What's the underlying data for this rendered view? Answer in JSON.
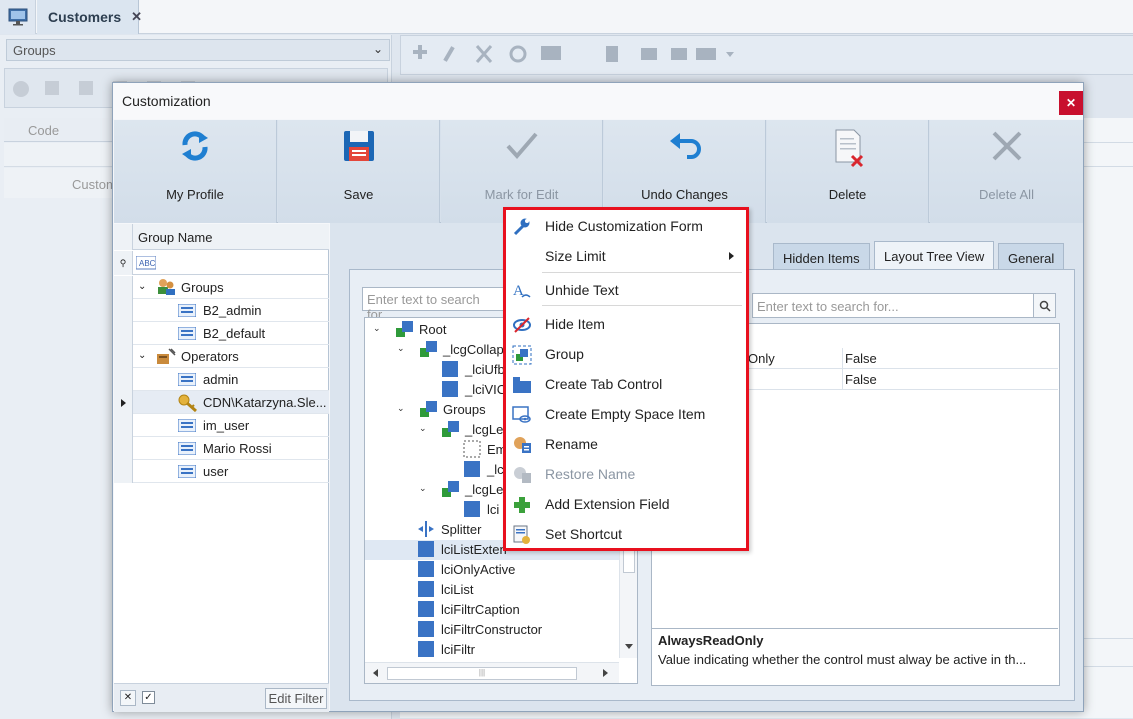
{
  "app": {
    "tab_title": "Customers",
    "tab_close": "✕",
    "groups_combo": "Groups",
    "left_grid_col": "Code",
    "left_grid_row": "Custom"
  },
  "dialog": {
    "title": "Customization",
    "close": "✕",
    "ribbon": [
      {
        "label": "My Profile",
        "icon": "refresh-icon",
        "enabled": true
      },
      {
        "label": "Save",
        "icon": "save-icon",
        "enabled": true
      },
      {
        "label": "Mark for Edit",
        "icon": "checkmark-icon",
        "enabled": false
      },
      {
        "label": "Undo Changes",
        "icon": "undo-icon",
        "enabled": true
      },
      {
        "label": "Delete",
        "icon": "delete-doc-icon",
        "enabled": true
      },
      {
        "label": "Delete All",
        "icon": "x-icon",
        "enabled": false
      }
    ]
  },
  "users_grid": {
    "header": "Group Name",
    "rows": [
      {
        "label": "Groups",
        "level": 0,
        "expanded": true
      },
      {
        "label": "B2_admin",
        "level": 1
      },
      {
        "label": "B2_default",
        "level": 1
      },
      {
        "label": "Operators",
        "level": 0,
        "expanded": true
      },
      {
        "label": "admin",
        "level": 1
      },
      {
        "label": "CDN\\Katarzyna.Sle...",
        "level": 1,
        "selected": true
      },
      {
        "label": "im_user",
        "level": 1
      },
      {
        "label": "Mario Rossi",
        "level": 1
      },
      {
        "label": "user",
        "level": 1
      }
    ],
    "edit_filter": "Edit Filter"
  },
  "tabs": [
    {
      "label": "Hidden Items",
      "active": false
    },
    {
      "label": "Layout Tree View",
      "active": true
    },
    {
      "label": "General",
      "active": false
    }
  ],
  "search_left_placeholder": "Enter text to search for...",
  "search_right_placeholder": "Enter text to search for...",
  "layout_tree": [
    {
      "label": "Root",
      "depth": 0,
      "arrow": "down"
    },
    {
      "label": "_lcgCollap",
      "depth": 1,
      "arrow": "down"
    },
    {
      "label": "_lciUfb",
      "depth": 2
    },
    {
      "label": "_lciVIC",
      "depth": 2
    },
    {
      "label": "Groups",
      "depth": 1,
      "arrow": "down"
    },
    {
      "label": "_lcgLef",
      "depth": 2,
      "arrow": "down"
    },
    {
      "label": "Em",
      "depth": 3,
      "kind": "empty"
    },
    {
      "label": "_lc",
      "depth": 3
    },
    {
      "label": "_lcgLef",
      "depth": 2,
      "arrow": "down"
    },
    {
      "label": "lci",
      "depth": 3
    },
    {
      "label": "Splitter",
      "depth": 1,
      "kind": "splitter"
    },
    {
      "label": "lciListExten",
      "depth": 1,
      "selected": true
    },
    {
      "label": "lciOnlyActive",
      "depth": 1
    },
    {
      "label": "lciList",
      "depth": 1
    },
    {
      "label": "lciFiltrCaption",
      "depth": 1
    },
    {
      "label": "lciFiltrConstructor",
      "depth": 1
    },
    {
      "label": "lciFiltr",
      "depth": 1
    }
  ],
  "properties": {
    "rows": [
      {
        "key": "Only",
        "value": "False"
      },
      {
        "key": "",
        "value": "False"
      }
    ],
    "desc_title": "AlwaysReadOnly",
    "desc_text": "Value indicating whether the control must alway be active in th..."
  },
  "context_menu": {
    "border_color": "#e8101e",
    "items": [
      {
        "label": "Hide Customization Form",
        "icon": "wrench-icon",
        "enabled": true
      },
      {
        "label": "Size Limit",
        "icon": "",
        "enabled": true,
        "submenu": true
      },
      {
        "label": "Unhide Text",
        "icon": "text-icon",
        "enabled": true
      },
      {
        "label": "Hide Item",
        "icon": "eye-slash-icon",
        "enabled": true
      },
      {
        "label": "Group",
        "icon": "group-icon",
        "enabled": true
      },
      {
        "label": "Create Tab Control",
        "icon": "tab-control-icon",
        "enabled": true
      },
      {
        "label": "Create Empty Space Item",
        "icon": "empty-space-icon",
        "enabled": true
      },
      {
        "label": "Rename",
        "icon": "rename-icon",
        "enabled": true
      },
      {
        "label": "Restore Name",
        "icon": "restore-name-icon",
        "enabled": false
      },
      {
        "label": "Add Extension Field",
        "icon": "plus-icon",
        "enabled": true
      },
      {
        "label": "Set Shortcut",
        "icon": "shortcut-icon",
        "enabled": true
      }
    ]
  }
}
